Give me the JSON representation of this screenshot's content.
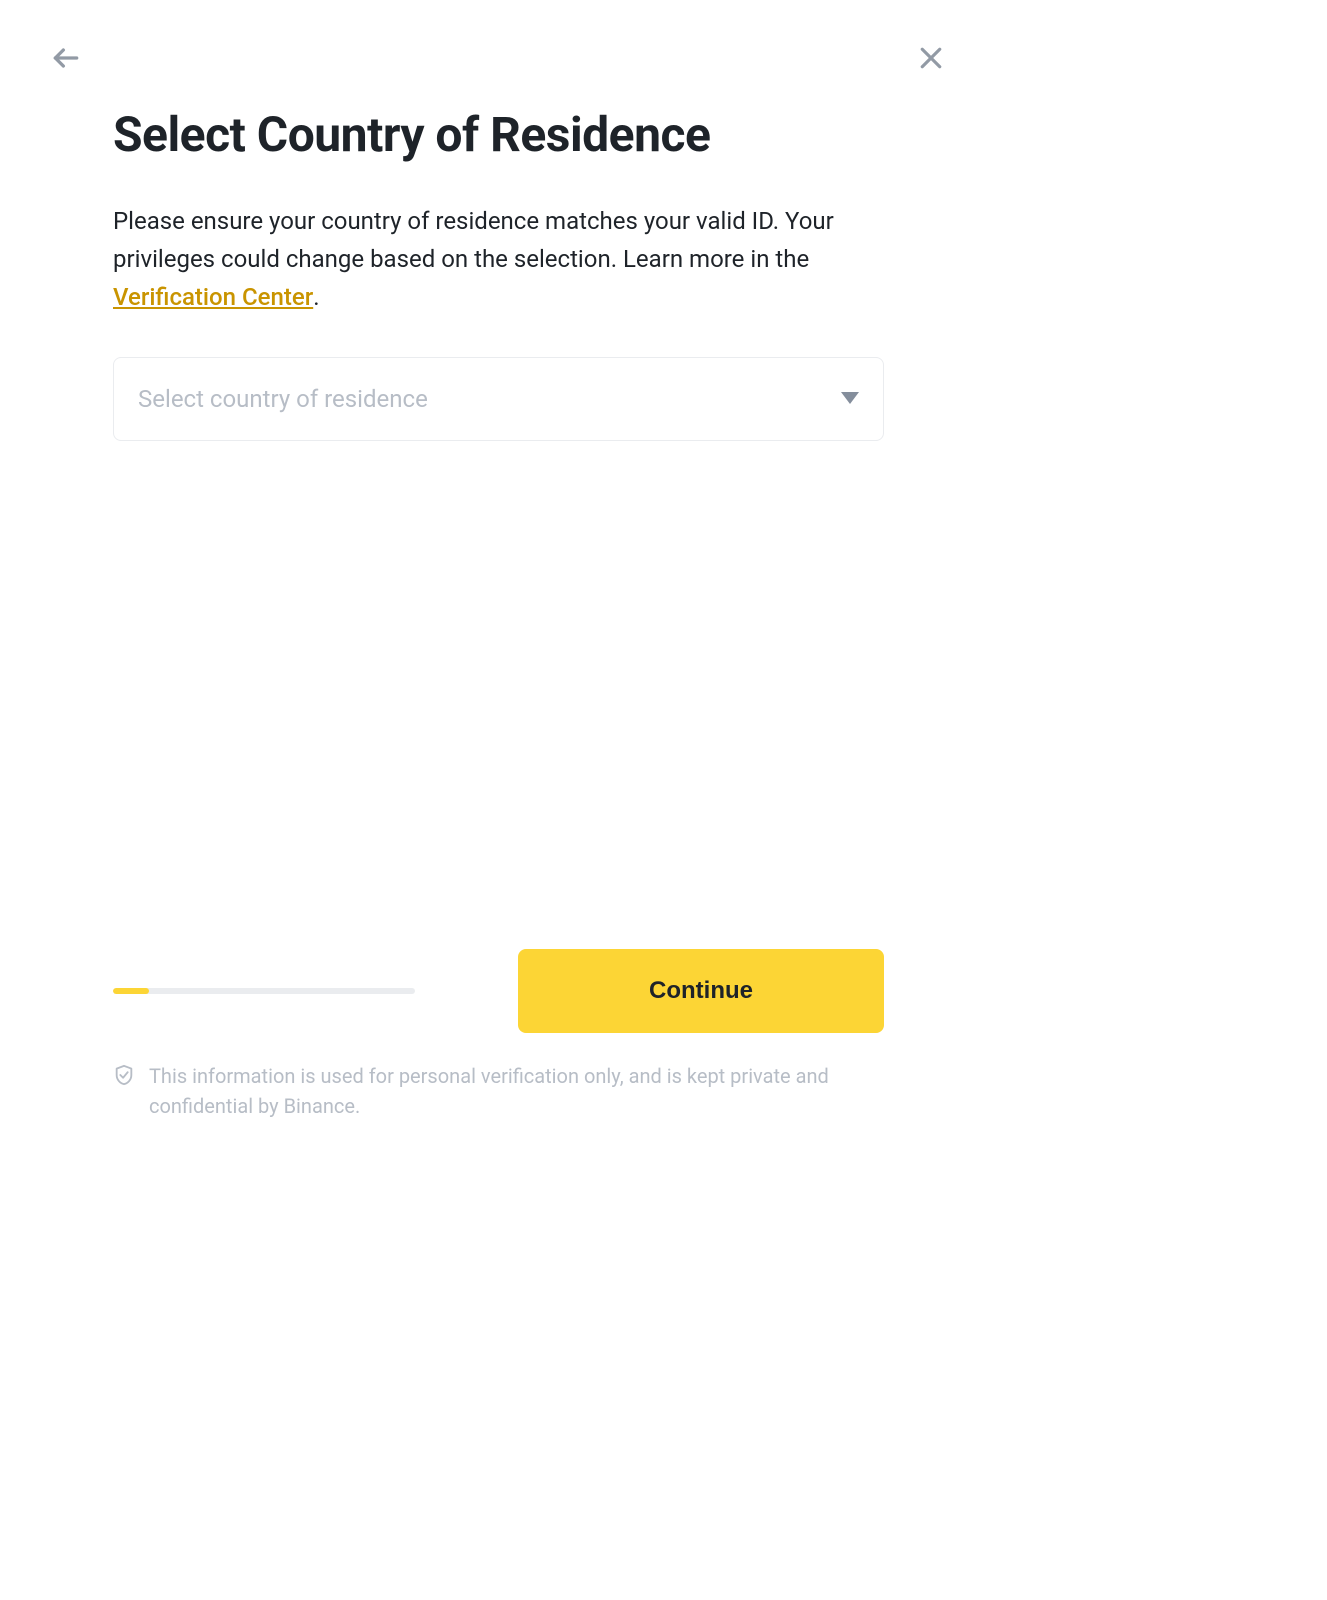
{
  "header": {
    "title": "Select Country of Residence"
  },
  "description": {
    "text_before_link": "Please ensure your country of residence matches your valid ID. Your privileges could change based on the selection. Learn more in the ",
    "link_text": "Verification Center",
    "text_after_link": "."
  },
  "select": {
    "placeholder": "Select country of residence"
  },
  "footer": {
    "continue_label": "Continue",
    "disclaimer": "This information is used for personal verification only, and is kept private and confidential by Binance.",
    "progress_percent": 12
  },
  "colors": {
    "accent": "#FCD535",
    "link": "#C99400",
    "text_primary": "#1E2329",
    "text_muted": "#B7BDC6",
    "border": "#EAECEF"
  }
}
